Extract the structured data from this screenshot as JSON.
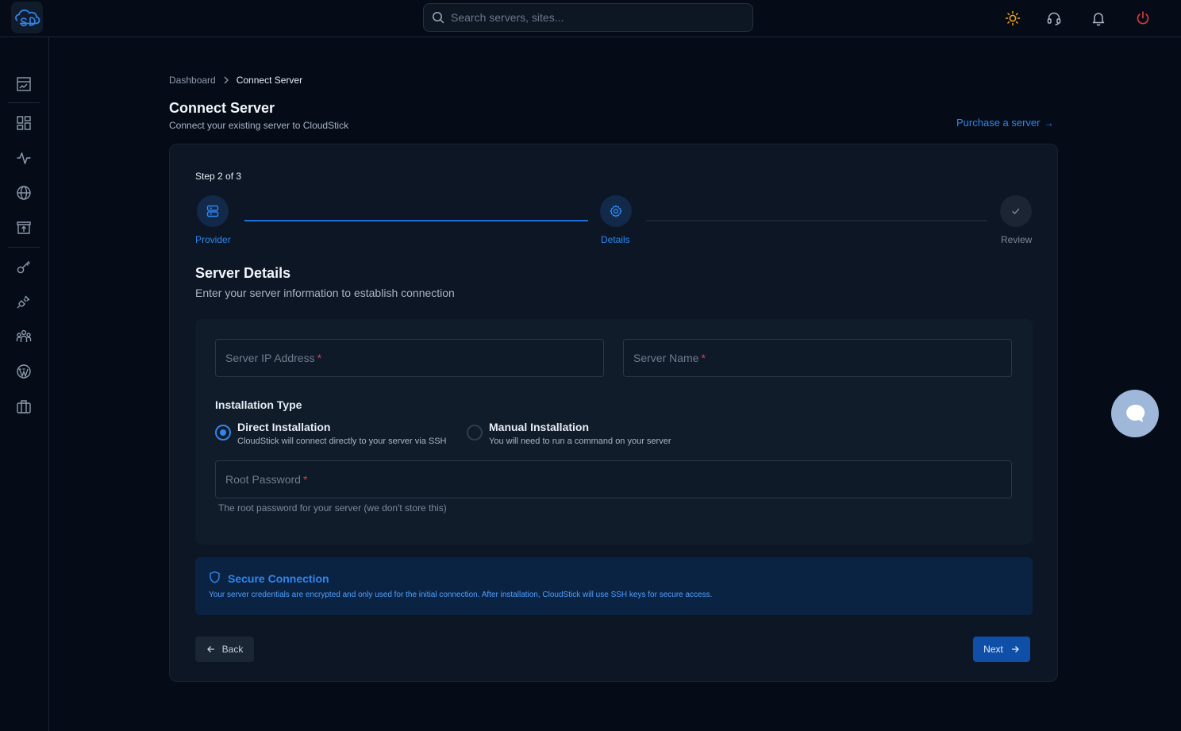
{
  "header": {
    "logo_icon": "cloudstick-logo",
    "search": {
      "placeholder": "Search servers, sites..."
    },
    "actions": [
      {
        "name": "theme-toggle",
        "icon": "sun-icon",
        "color": "#f2a51a"
      },
      {
        "name": "support",
        "icon": "headset-icon",
        "color": "#aab4c2"
      },
      {
        "name": "notifications",
        "icon": "bell-icon",
        "color": "#aab4c2"
      },
      {
        "name": "logout",
        "icon": "power-icon",
        "color": "#e23c3c"
      }
    ]
  },
  "sidebar": {
    "items": [
      {
        "icon": "dashboard-chart-icon"
      },
      {
        "icon": "apps-grid-icon"
      },
      {
        "icon": "activity-icon"
      },
      {
        "icon": "globe-icon"
      },
      {
        "icon": "archive-upload-icon"
      },
      {
        "icon": "key-icon"
      },
      {
        "icon": "plug-icon"
      },
      {
        "icon": "team-icon"
      },
      {
        "icon": "wordpress-icon"
      },
      {
        "icon": "briefcase-icon"
      }
    ]
  },
  "breadcrumb": {
    "parent": "Dashboard",
    "separator": ">",
    "current": "Connect Server"
  },
  "page": {
    "title": "Connect Server",
    "subtitle": "Connect your existing server to CloudStick",
    "purchase_link": "Purchase a server",
    "purchase_arrow": "→"
  },
  "wizard": {
    "step_text": "Step 2 of 3",
    "steps": [
      {
        "label": "Provider",
        "icon": "server-icon",
        "state": "complete"
      },
      {
        "label": "Details",
        "icon": "gear-icon",
        "state": "active"
      },
      {
        "label": "Review",
        "icon": "check-icon",
        "state": "pending"
      }
    ]
  },
  "details": {
    "title": "Server Details",
    "subtitle": "Enter your server information to establish connection",
    "fields": {
      "ip": {
        "placeholder": "Server IP Address",
        "value": "",
        "required_mark": "*"
      },
      "name": {
        "placeholder": "Server Name",
        "value": "",
        "required_mark": "*"
      },
      "password": {
        "placeholder": "Root Password",
        "value": "",
        "required_mark": "*",
        "helper": "The root password for your server (we don't store this)"
      }
    },
    "installation": {
      "label": "Installation Type",
      "options": [
        {
          "title": "Direct Installation",
          "description": "CloudStick will connect directly to your server via SSH",
          "selected": true
        },
        {
          "title": "Manual Installation",
          "description": "You will need to run a command on your server",
          "selected": false
        }
      ]
    }
  },
  "secure": {
    "icon": "shield-icon",
    "title": "Secure Connection",
    "description": "Your server credentials are encrypted and only used for the initial connection. After installation, CloudStick will use SSH keys for secure access."
  },
  "buttons": {
    "back": "Back",
    "next": "Next"
  },
  "chat": {
    "icon": "chat-bubble-icon"
  },
  "colors": {
    "accent": "#2f86ee",
    "required": "#e23c3c",
    "background": "#050c18",
    "card": "#0d1624"
  }
}
